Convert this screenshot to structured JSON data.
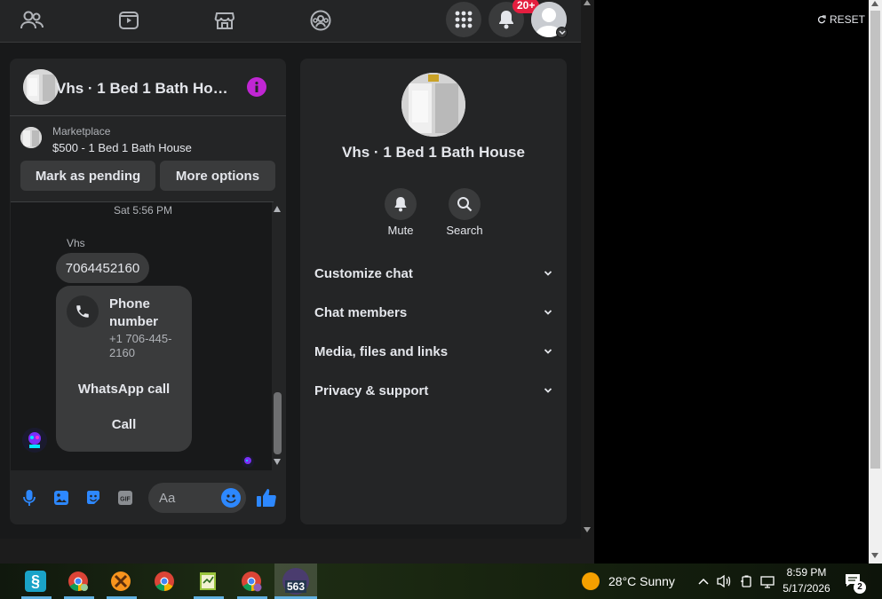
{
  "nav": {
    "notif_count": "20+"
  },
  "browser": {
    "reset_label": "RESET"
  },
  "chat": {
    "title": "Vhs · 1 Bed 1 Bath Hou···",
    "listing": {
      "source": "Marketplace",
      "name": "$500 - 1 Bed 1 Bath House"
    },
    "mark_pending": "Mark as pending",
    "more_options": "More options",
    "timestamp": "Sat 5:56 PM",
    "sender": "Vhs",
    "message": "7064452160",
    "phone_card": {
      "title": "Phone number",
      "number": "+1 706-445-2160",
      "whatsapp": "WhatsApp call",
      "call": "Call"
    },
    "composer_placeholder": "Aa"
  },
  "details": {
    "name": "Vhs · 1 Bed 1 Bath House",
    "mute": "Mute",
    "search": "Search",
    "sections": [
      "Customize chat",
      "Chat members",
      "Media, files and links",
      "Privacy & support"
    ]
  },
  "taskbar": {
    "weather": "28°C  Sunny",
    "time": "8:59 PM",
    "date": "5/17/2026",
    "app_badge": "563",
    "notif": "2"
  },
  "colors": {
    "accent": "#2d88ff",
    "info": "#c026d3",
    "badge": "#e41e3f",
    "panel": "#242526",
    "bg": "#18191a"
  }
}
